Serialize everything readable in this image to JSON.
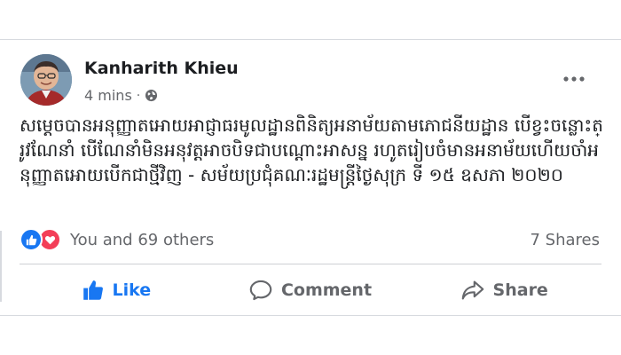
{
  "post": {
    "author": "Kanharith Khieu",
    "time": "4 mins",
    "separator": "·",
    "privacy_icon": "globe-icon",
    "options_icon": "more-horizontal-icon",
    "text": "សម្តេចបានអនុញ្ញាតអោយអាជ្ញាធរមូលដ្ឋានពិនិត្យអនាម័យតាមភោជនីយដ្ឋាន បើខ្វះចន្លោះត្រូវណែនាំ បើណែនាំមិនអនុវត្តអាចបិទជាបណ្តោះអាសន្ន រហូតរៀបចំមានអនាម័យហើយចាំអនុញ្ញាតអោយបើកជាថ្មីវិញ - សម័យប្រជុំគណៈរដ្ឋមន្ត្រីថ្ងៃសុក្រ ទី ១៥ ឧសភា ២០២០"
  },
  "stats": {
    "reactions_text": "You and 69 others",
    "reaction_icons": [
      "like-reaction-icon",
      "love-reaction-icon"
    ],
    "shares_text": "7 Shares"
  },
  "actions": {
    "like": "Like",
    "comment": "Comment",
    "share": "Share"
  },
  "colors": {
    "like_blue": "#1877f2",
    "love_red": "#f33e58",
    "meta_gray": "#65676b",
    "text": "#1c1e21"
  }
}
